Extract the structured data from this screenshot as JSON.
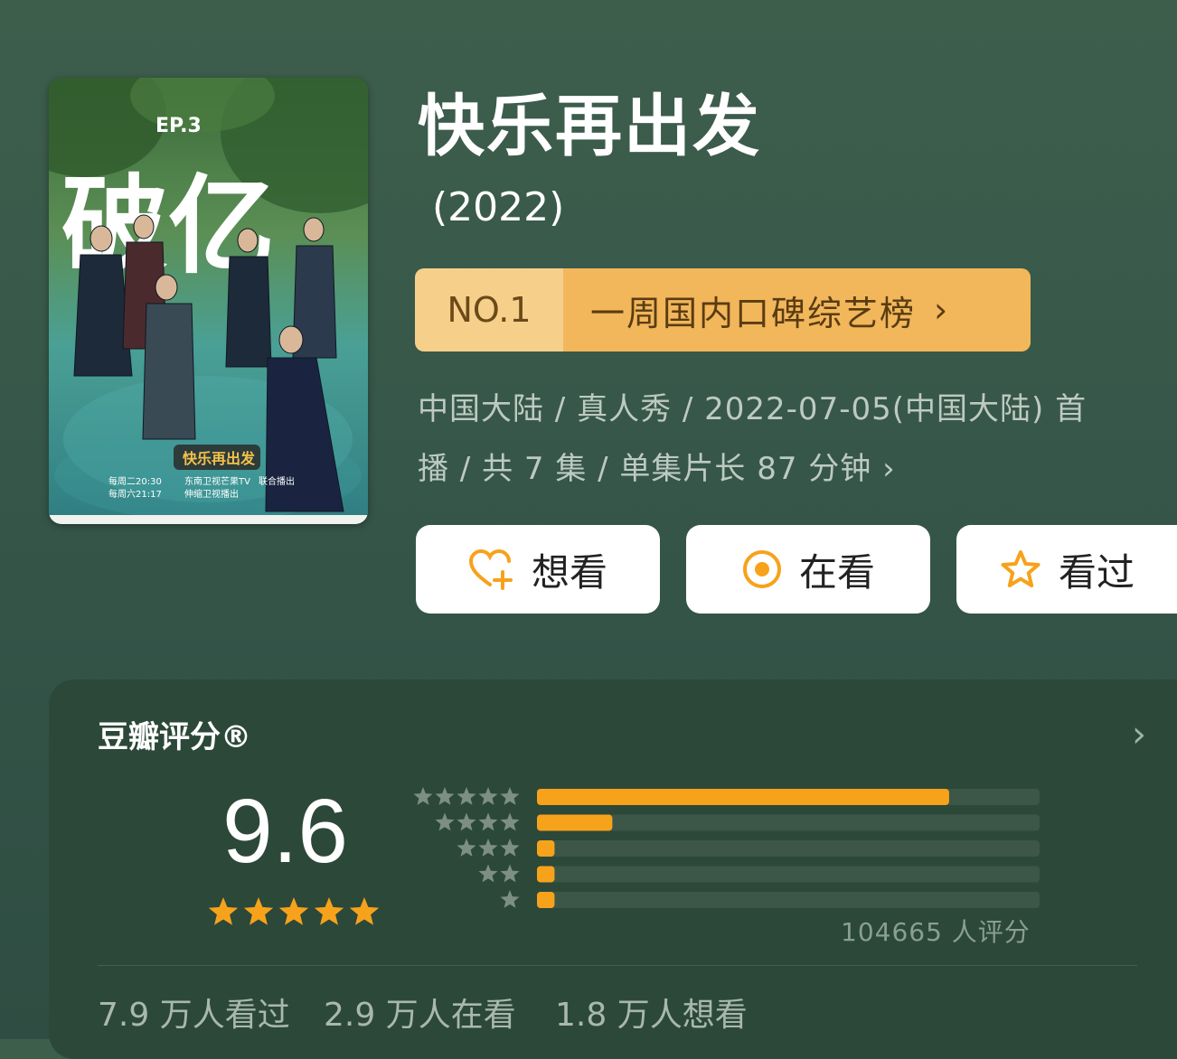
{
  "show": {
    "title": "快乐再出发",
    "year": "(2022)",
    "poster": {
      "alt_texts": [
        "破亿",
        "EP.3",
        "快乐再出发",
        "每周二20:30",
        "每周六21:17",
        "东南卫视",
        "芒果TV",
        "联合播出",
        "伸缩卫视播出"
      ]
    }
  },
  "ranking": {
    "no": "NO.1",
    "label": "一周国内口碑综艺榜",
    "chevron": "›"
  },
  "meta": {
    "line1": "中国大陆 / 真人秀 / 2022-07-05(中国大陆) 首",
    "line2": "播 / 共 7 集 / 单集片长 87 分钟 ›"
  },
  "actions": [
    {
      "label": "想看",
      "icon": "heart-plus-icon"
    },
    {
      "label": "在看",
      "icon": "target-icon"
    },
    {
      "label": "看过",
      "icon": "star-outline-icon"
    }
  ],
  "rating": {
    "title": "豆瓣评分®",
    "chevron": "›",
    "score": "9.6",
    "stars": 5,
    "distribution": [
      {
        "stars": 5,
        "fraction": 0.82
      },
      {
        "stars": 4,
        "fraction": 0.15
      },
      {
        "stars": 3,
        "fraction": 0.035
      },
      {
        "stars": 2,
        "fraction": 0.035
      },
      {
        "stars": 1,
        "fraction": 0.035
      }
    ],
    "count_text": "104665 人评分"
  },
  "stats": [
    "7.9 万人看过",
    "2.9 万人在看",
    "1.8 万人想看"
  ],
  "colors": {
    "accent": "#f7a21b",
    "rank_light": "#f6cf8b",
    "rank_dark": "#f2b75b",
    "card_bg": "#2c4839",
    "bar_track": "#3c5648"
  }
}
